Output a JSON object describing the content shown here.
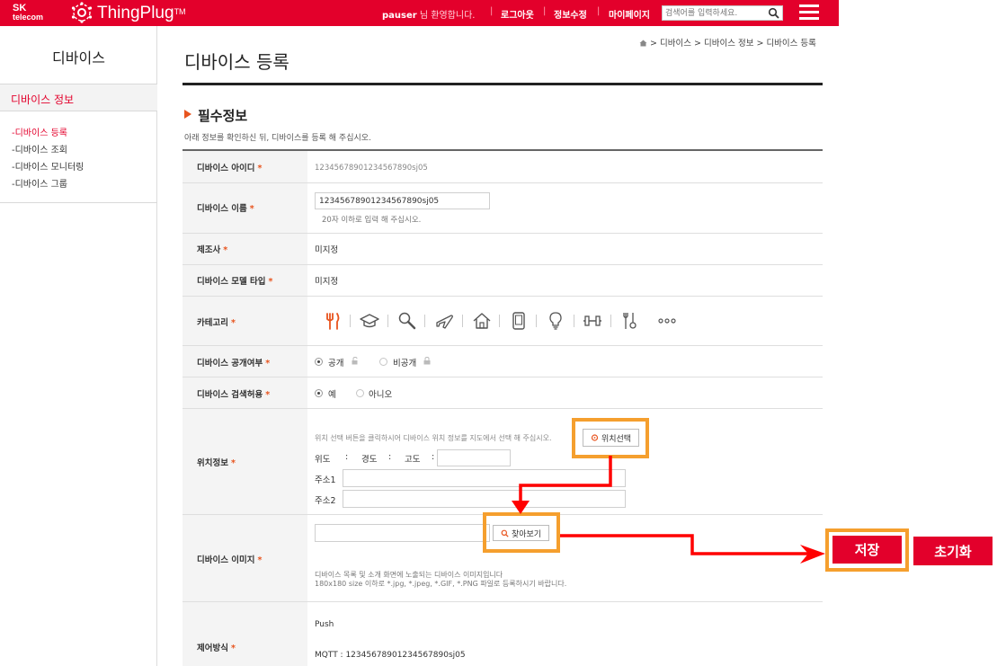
{
  "brand": {
    "sk_top": "SK",
    "sk_bottom": "telecom",
    "product": "ThingPlug",
    "tm": "TM"
  },
  "topbar": {
    "user": "pauser",
    "welcome": "님 환영합니다.",
    "logout": "로그아웃",
    "edit_info": "정보수정",
    "mypage": "마이페이지",
    "search_placeholder": "검색어를 입력하세요."
  },
  "sidebar": {
    "title": "디바이스",
    "section": "디바이스 정보",
    "items": [
      {
        "label": "-디바이스 등록",
        "active": true
      },
      {
        "label": "-디바이스 조회",
        "active": false
      },
      {
        "label": "-디바이스 모니터링",
        "active": false
      },
      {
        "label": "-디바이스 그룹",
        "active": false
      }
    ]
  },
  "breadcrumb": {
    "items": [
      "디바이스",
      "디바이스 정보",
      "디바이스 등록"
    ]
  },
  "page": {
    "title": "디바이스 등록",
    "section_title": "필수정보",
    "section_desc": "아래 정보를 확인하신 뒤, 디바이스를 등록 해 주십시오."
  },
  "form": {
    "required_mark": "*",
    "device_id": {
      "label": "디바이스 아이디",
      "value": "12345678901234567890sj05"
    },
    "device_name": {
      "label": "디바이스 이름",
      "value": "12345678901234567890sj05",
      "hint": "20자 이하로 입력 해 주십시오."
    },
    "manufacturer": {
      "label": "제조사",
      "value": "미지정"
    },
    "model_type": {
      "label": "디바이스 모델 타입",
      "value": "미지정"
    },
    "category": {
      "label": "카테고리",
      "icons": [
        "fork-knife-icon",
        "graduation-cap-icon",
        "magnifier-icon",
        "airplane-icon",
        "home-icon",
        "smartphone-icon",
        "lightbulb-icon",
        "dumbbell-icon",
        "tools-icon",
        "more-icon"
      ]
    },
    "visibility": {
      "label": "디바이스 공개여부",
      "options": [
        "공개",
        "비공개"
      ],
      "selected": "공개"
    },
    "searchable": {
      "label": "디바이스 검색허용",
      "options": [
        "예",
        "아니오"
      ],
      "selected": "예"
    },
    "location": {
      "label": "위치정보",
      "desc": "위치 선택 버튼을 클릭하시어 디바이스 위치 정보를 지도에서 선택 해 주십시오.",
      "button": "위치선택",
      "lat": "위도",
      "lng": "경도",
      "alt": "고도",
      "colon": ":",
      "addr1": "주소1",
      "addr2": "주소2"
    },
    "image": {
      "label": "디바이스 이미지",
      "button": "찾아보기",
      "desc1": "디바이스 목록 및 소개 화면에 노출되는 디바이스 이미지입니다",
      "desc2": "180x180 size 이하로 *.jpg, *.jpeg, *.GIF, *.PNG 파일로 등록하시기 바랍니다."
    },
    "control": {
      "label": "제어방식",
      "push": "Push",
      "mqtt": "MQTT : 12345678901234567890sj05"
    }
  },
  "actions": {
    "save": "저장",
    "reset": "초기화"
  },
  "colors": {
    "brand_red": "#e3002b",
    "highlight_orange": "#f59f2e",
    "arrow_red": "#ff0000"
  }
}
